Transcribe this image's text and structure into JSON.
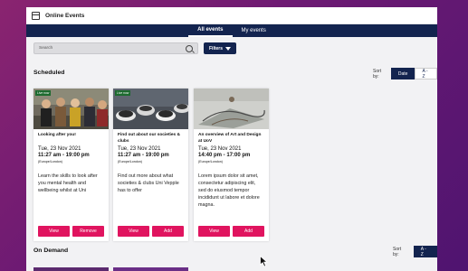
{
  "titlebar": {
    "title": "Online Events"
  },
  "tabs": [
    {
      "label": "All events"
    },
    {
      "label": "My events"
    }
  ],
  "search": {
    "placeholder": "Search"
  },
  "filters": {
    "label": "Filters"
  },
  "scheduled": {
    "title": "Scheduled",
    "sort_label": "Sort by:",
    "sort_options": [
      "Date",
      "A - Z"
    ]
  },
  "on_demand": {
    "title": "On Demand",
    "sort_label": "Sort by:",
    "sort_option": "A - Z"
  },
  "cards": [
    {
      "badge": "Live now",
      "title": "Looking after you!",
      "date": "Tue, 23 Nov 2021",
      "time": "11:27 am - 19:00 pm",
      "tz": "(Europe/London)",
      "desc": "Learn the skills to look after you mental health and wellbeing whilst at Uni",
      "btn1": "View",
      "btn2": "Remove"
    },
    {
      "badge": "Live now",
      "title": "Find out about our societies & clubs",
      "date": "Tue, 23 Nov 2021",
      "time": "11:27 am - 19:00 pm",
      "tz": "(Europe/London)",
      "desc": "Find out more about what societies & clubs Uni Vepple has to offer",
      "btn1": "View",
      "btn2": "Add"
    },
    {
      "badge": "",
      "title": "An overview of Art and Design at UoV",
      "date": "Tue, 23 Nov 2021",
      "time": "14:40 pm - 17:00 pm",
      "tz": "(Europe/London)",
      "desc": "Lorem ipsum dolor sit amet, consectetur adipiscing elit, sed do eiusmod tempor incididunt ut labore et dolore magna.",
      "btn1": "View",
      "btn2": "Add"
    }
  ],
  "colors": {
    "navy": "#13244f",
    "accent": "#e0145f",
    "live_badge": "#1c6a2e"
  }
}
